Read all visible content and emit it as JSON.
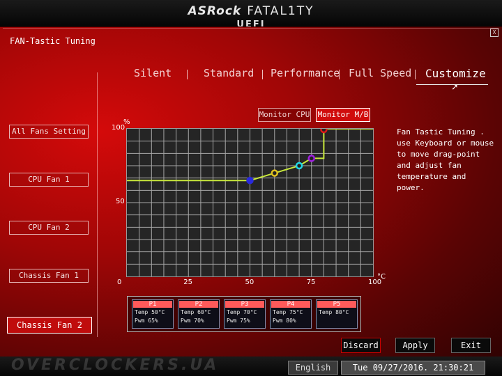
{
  "header": {
    "brand": "ASRock",
    "product": "FATAL1TY",
    "firmware": "UEFI"
  },
  "page": {
    "title": "FAN-Tastic Tuning",
    "close_label": "X"
  },
  "tabs": [
    {
      "label": "Silent",
      "active": false
    },
    {
      "label": "Standard",
      "active": false
    },
    {
      "label": "Performance",
      "active": false
    },
    {
      "label": "Full Speed",
      "active": false
    },
    {
      "label": "Customize",
      "active": true
    }
  ],
  "fans": [
    {
      "label": "All Fans Setting",
      "active": false
    },
    {
      "label": "CPU Fan 1",
      "active": false
    },
    {
      "label": "CPU Fan 2",
      "active": false
    },
    {
      "label": "Chassis Fan 1",
      "active": false
    },
    {
      "label": "Chassis Fan 2",
      "active": true
    }
  ],
  "monitor": {
    "cpu_label": "Monitor CPU",
    "mb_label": "Monitor M/B",
    "selected": "Monitor M/B"
  },
  "help_text": "Fan Tastic Tuning . use Keyboard or mouse to move drag-point and adjust fan temperature and power.",
  "chart_data": {
    "type": "line",
    "x_unit": "°C",
    "y_unit": "%",
    "xlim": [
      0,
      100
    ],
    "ylim": [
      0,
      100
    ],
    "x_ticks": [
      0,
      25,
      50,
      75,
      100
    ],
    "y_ticks": [
      50,
      100
    ],
    "grid": true,
    "curve": [
      {
        "x": 0,
        "y": 65
      },
      {
        "x": 50,
        "y": 65
      },
      {
        "x": 60,
        "y": 70
      },
      {
        "x": 70,
        "y": 75
      },
      {
        "x": 75,
        "y": 80
      },
      {
        "x": 80,
        "y": 80
      },
      {
        "x": 80,
        "y": 100
      },
      {
        "x": 100,
        "y": 100
      }
    ],
    "points": [
      {
        "name": "P1",
        "x": 50,
        "y": 65,
        "color": "#2a2adc"
      },
      {
        "name": "P2",
        "x": 60,
        "y": 70,
        "color": "#e0c020"
      },
      {
        "name": "P3",
        "x": 70,
        "y": 75,
        "color": "#20d8e8"
      },
      {
        "name": "P4",
        "x": 75,
        "y": 80,
        "color": "#a020e0"
      },
      {
        "name": "P5",
        "x": 80,
        "y": 100,
        "color": "#e01818"
      }
    ],
    "line_color": "#c8e83c"
  },
  "point_table": [
    {
      "name": "P1",
      "temp": "Temp 50°C",
      "pwm": "Pwm  65%"
    },
    {
      "name": "P2",
      "temp": "Temp 60°C",
      "pwm": "Pwm  70%"
    },
    {
      "name": "P3",
      "temp": "Temp 70°C",
      "pwm": "Pwm  75%"
    },
    {
      "name": "P4",
      "temp": "Temp 75°C",
      "pwm": "Pwm  80%"
    },
    {
      "name": "P5",
      "temp": "Temp 80°C",
      "pwm": ""
    }
  ],
  "actions": {
    "discard": "Discard",
    "apply": "Apply",
    "exit": "Exit"
  },
  "footer": {
    "watermark": "OVERCLOCKERS.UA",
    "language": "English",
    "datetime": "Tue 09/27/2016. 21:30:21"
  }
}
